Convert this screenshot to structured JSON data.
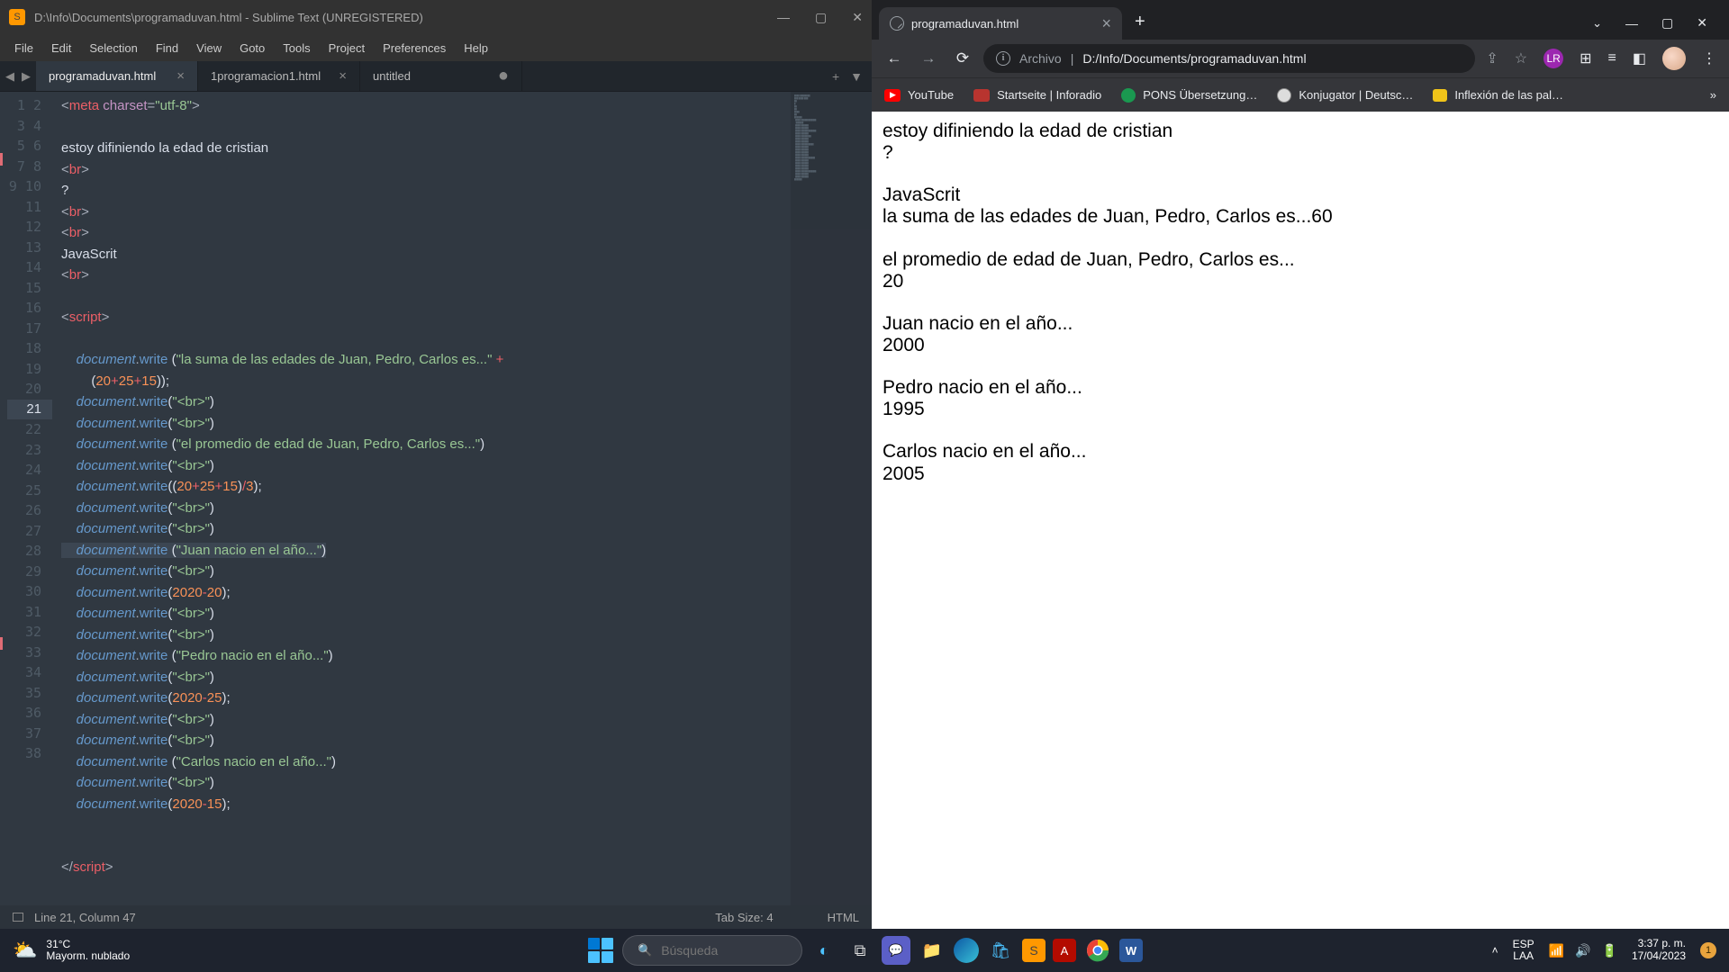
{
  "sublime": {
    "title": "D:\\Info\\Documents\\programaduvan.html - Sublime Text (UNREGISTERED)",
    "menu": [
      "File",
      "Edit",
      "Selection",
      "Find",
      "View",
      "Goto",
      "Tools",
      "Project",
      "Preferences",
      "Help"
    ],
    "tabs": [
      {
        "name": "programaduvan.html",
        "active": true,
        "dirty": false
      },
      {
        "name": "1programacion1.html",
        "active": false,
        "dirty": false
      },
      {
        "name": "untitled",
        "active": false,
        "dirty": true
      }
    ],
    "status": {
      "left": "Line 21, Column 47",
      "tabsize": "Tab Size: 4",
      "syntax": "HTML"
    },
    "highlighted_line": 21,
    "code_lines": 38
  },
  "chrome": {
    "tab_title": "programaduvan.html",
    "url_label": "Archivo",
    "url_path": "D:/Info/Documents/programaduvan.html",
    "bookmarks": [
      {
        "label": "YouTube",
        "color": "#ff0000"
      },
      {
        "label": "Startseite | Inforadio",
        "color": "#b8342f"
      },
      {
        "label": "PONS Übersetzung…",
        "color": "#1a9850"
      },
      {
        "label": "Konjugator | Deutsc…",
        "color": "#888"
      },
      {
        "label": "Inflexión de las pal…",
        "color": "#f0c419"
      }
    ],
    "page": {
      "b1a": "estoy difiniendo la edad de cristian",
      "b1b": "?",
      "b2a": "JavaScrit",
      "b2b": "la suma de las edades de Juan, Pedro, Carlos es...60",
      "b3a": "el promedio de edad de Juan, Pedro, Carlos es...",
      "b3b": "20",
      "b4a": "Juan nacio en el año...",
      "b4b": "2000",
      "b5a": "Pedro nacio en el año...",
      "b5b": "1995",
      "b6a": "Carlos nacio en el año...",
      "b6b": "2005"
    }
  },
  "taskbar": {
    "temp": "31°C",
    "weather": "Mayorm. nublado",
    "search_placeholder": "Búsqueda",
    "lang1": "ESP",
    "lang2": "LAA",
    "time": "3:37 p. m.",
    "date": "17/04/2023",
    "notif": "1"
  }
}
